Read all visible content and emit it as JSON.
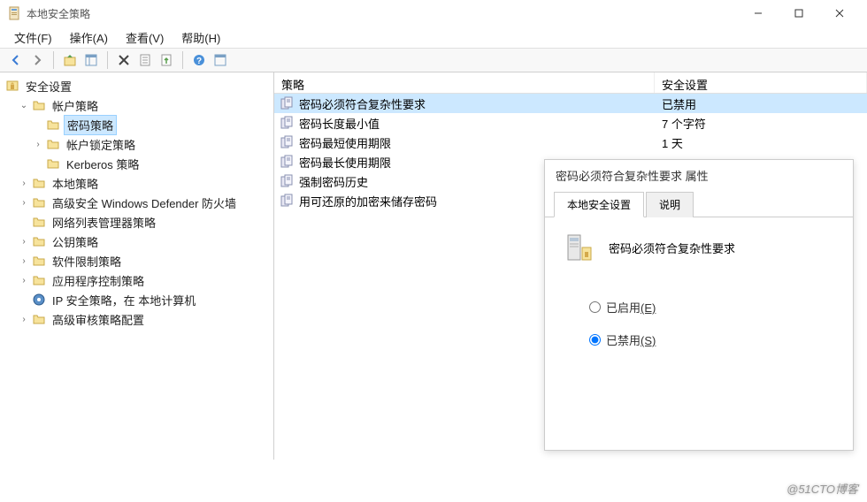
{
  "window": {
    "title": "本地安全策略"
  },
  "menu": {
    "file": "文件(F)",
    "action": "操作(A)",
    "view": "查看(V)",
    "help": "帮助(H)"
  },
  "tree": {
    "root": "安全设置",
    "account_policies": "帐户策略",
    "password_policy": "密码策略",
    "account_lockout": "帐户锁定策略",
    "kerberos": "Kerberos 策略",
    "local_policies": "本地策略",
    "defender": "高级安全 Windows Defender 防火墙",
    "network_list": "网络列表管理器策略",
    "public_key": "公钥策略",
    "software_restrict": "软件限制策略",
    "app_control": "应用程序控制策略",
    "ip_security": "IP 安全策略，在 本地计算机",
    "advanced_audit": "高级审核策略配置"
  },
  "list": {
    "header_policy": "策略",
    "header_setting": "安全设置",
    "rows": [
      {
        "policy": "密码必须符合复杂性要求",
        "setting": "已禁用"
      },
      {
        "policy": "密码长度最小值",
        "setting": "7 个字符"
      },
      {
        "policy": "密码最短使用期限",
        "setting": "1 天"
      },
      {
        "policy": "密码最长使用期限",
        "setting": ""
      },
      {
        "policy": "强制密码历史",
        "setting": ""
      },
      {
        "policy": "用可还原的加密来储存密码",
        "setting": ""
      }
    ]
  },
  "prop": {
    "title": "密码必须符合复杂性要求 属性",
    "tab_local": "本地安全设置",
    "tab_explain": "说明",
    "name": "密码必须符合复杂性要求",
    "enabled_label": "已启用",
    "enabled_hotkey": "(E)",
    "disabled_label": "已禁用",
    "disabled_hotkey": "(S)"
  },
  "watermark": "@51CTO博客"
}
